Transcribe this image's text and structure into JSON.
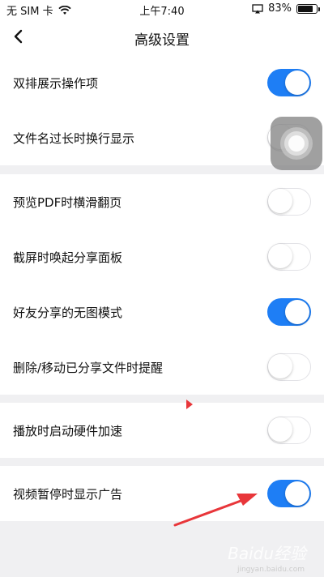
{
  "status_bar": {
    "carrier": "无 SIM 卡",
    "time": "上午7:40",
    "battery_percent": "83%",
    "battery_level": 0.83,
    "icons": [
      "wifi-icon",
      "airplay-icon",
      "battery-icon"
    ]
  },
  "navbar": {
    "title": "高级设置",
    "back_icon": "chevron-left-icon"
  },
  "settings": [
    {
      "label": "双排展示操作项",
      "enabled": true
    },
    {
      "label": "文件名过长时换行显示",
      "enabled": false
    },
    {
      "label": "预览PDF时横滑翻页",
      "enabled": false
    },
    {
      "label": "截屏时唤起分享面板",
      "enabled": false
    },
    {
      "label": "好友分享的无图模式",
      "enabled": true
    },
    {
      "label": "删除/移动已分享文件时提醒",
      "enabled": false
    },
    {
      "label": "播放时启动硬件加速",
      "enabled": false
    },
    {
      "label": "视频暂停时显示广告",
      "enabled": true
    }
  ],
  "colors": {
    "accent": "#1e7ef5",
    "annotation": "#e8363a",
    "background": "#f0f0f2"
  },
  "watermark": {
    "text": "Baidu经验",
    "sub": "jingyan.baidu.com"
  }
}
